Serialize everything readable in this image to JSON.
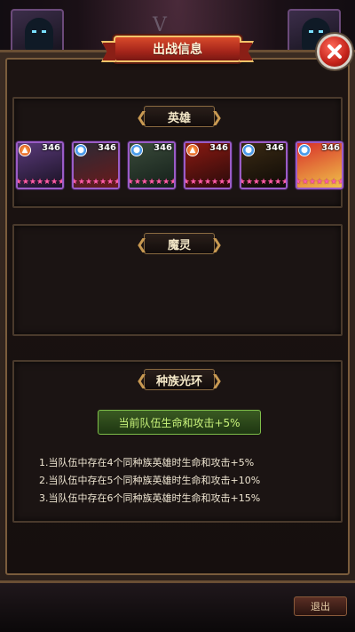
{
  "modal": {
    "title": "出战信息",
    "exit_label": "退出"
  },
  "background": {
    "emblem": "V"
  },
  "heroes_section": {
    "title": "英雄",
    "heroes": [
      {
        "element": "fire",
        "element_icon": "fire-icon",
        "power": "346",
        "stars": "★★★★★★★",
        "portrait": "purple-hooded-hero"
      },
      {
        "element": "water",
        "element_icon": "water-drop-icon",
        "power": "346",
        "stars": "★★★★★★★",
        "portrait": "red-cloaked-hero"
      },
      {
        "element": "water",
        "element_icon": "water-drop-icon",
        "power": "346",
        "stars": "★★★★★★★",
        "portrait": "green-hooded-hero"
      },
      {
        "element": "fire",
        "element_icon": "fire-icon",
        "power": "346",
        "stars": "★★★★★★★",
        "portrait": "red-armored-hero"
      },
      {
        "element": "water",
        "element_icon": "water-drop-icon",
        "power": "346",
        "stars": "★★★★★★★",
        "portrait": "dark-gold-hero"
      },
      {
        "element": "water",
        "element_icon": "water-drop-icon",
        "power": "346",
        "stars": "★★★★★★★",
        "portrait": "red-lion-hero"
      }
    ]
  },
  "spirit_section": {
    "title": "魔灵"
  },
  "race_section": {
    "title": "种族光环",
    "current_bonus": "当前队伍生命和攻击+5%",
    "rules": [
      "1.当队伍中存在4个同种族英雄时生命和攻击+5%",
      "2.当队伍中存在5个同种族英雄时生命和攻击+10%",
      "3.当队伍中存在6个同种族英雄时生命和攻击+15%"
    ]
  },
  "colors": {
    "title_ribbon": "#a6261b",
    "star": "#ff5fa8",
    "hero_border": "#9a5cc6",
    "bonus_text": "#c8f27a"
  }
}
